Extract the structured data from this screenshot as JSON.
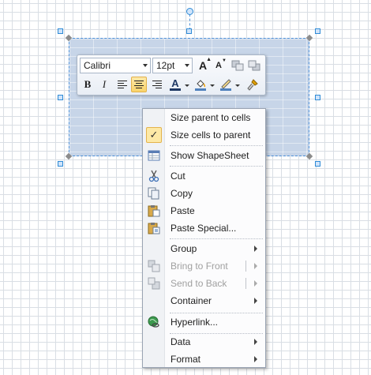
{
  "mini_toolbar": {
    "font_name": "Calibri",
    "font_size": "12pt",
    "bold": "B",
    "italic": "I",
    "font_color_letter": "A",
    "grow_font": "A",
    "shrink_font": "A",
    "icons": [
      "grow-font-icon",
      "shrink-font-icon",
      "bring-forward-icon",
      "send-backward-icon",
      "bold-icon",
      "italic-icon",
      "align-left-icon",
      "align-center-icon",
      "align-right-icon",
      "font-color-icon",
      "fill-color-icon",
      "line-color-icon",
      "format-painter-icon"
    ],
    "colors": {
      "font_color": "#c00000",
      "fill_color": "#4f81bd",
      "line_color": "#4f81bd",
      "active_bg": "#f9d36b"
    }
  },
  "context_menu": {
    "items": [
      {
        "label": "Size parent to cells",
        "enabled": true
      },
      {
        "label": "Size cells to parent",
        "enabled": true,
        "checked": true
      },
      {
        "label": "Show ShapeSheet",
        "enabled": true,
        "icon": "shapesheet-icon"
      },
      {
        "label": "Cut",
        "enabled": true,
        "icon": "scissors-icon"
      },
      {
        "label": "Copy",
        "enabled": true,
        "icon": "copy-icon"
      },
      {
        "label": "Paste",
        "enabled": true,
        "icon": "paste-icon"
      },
      {
        "label": "Paste Special...",
        "enabled": true,
        "icon": "paste-special-icon"
      },
      {
        "label": "Group",
        "enabled": true,
        "submenu": true
      },
      {
        "label": "Bring to Front",
        "enabled": false,
        "submenu": true,
        "icon": "bring-to-front-icon"
      },
      {
        "label": "Send to Back",
        "enabled": false,
        "submenu": true,
        "icon": "send-to-back-icon"
      },
      {
        "label": "Container",
        "enabled": true,
        "submenu": true
      },
      {
        "label": "Hyperlink...",
        "enabled": true,
        "icon": "hyperlink-icon"
      },
      {
        "label": "Data",
        "enabled": true,
        "submenu": true
      },
      {
        "label": "Format",
        "enabled": true,
        "submenu": true
      }
    ],
    "check_mark": "✓"
  }
}
